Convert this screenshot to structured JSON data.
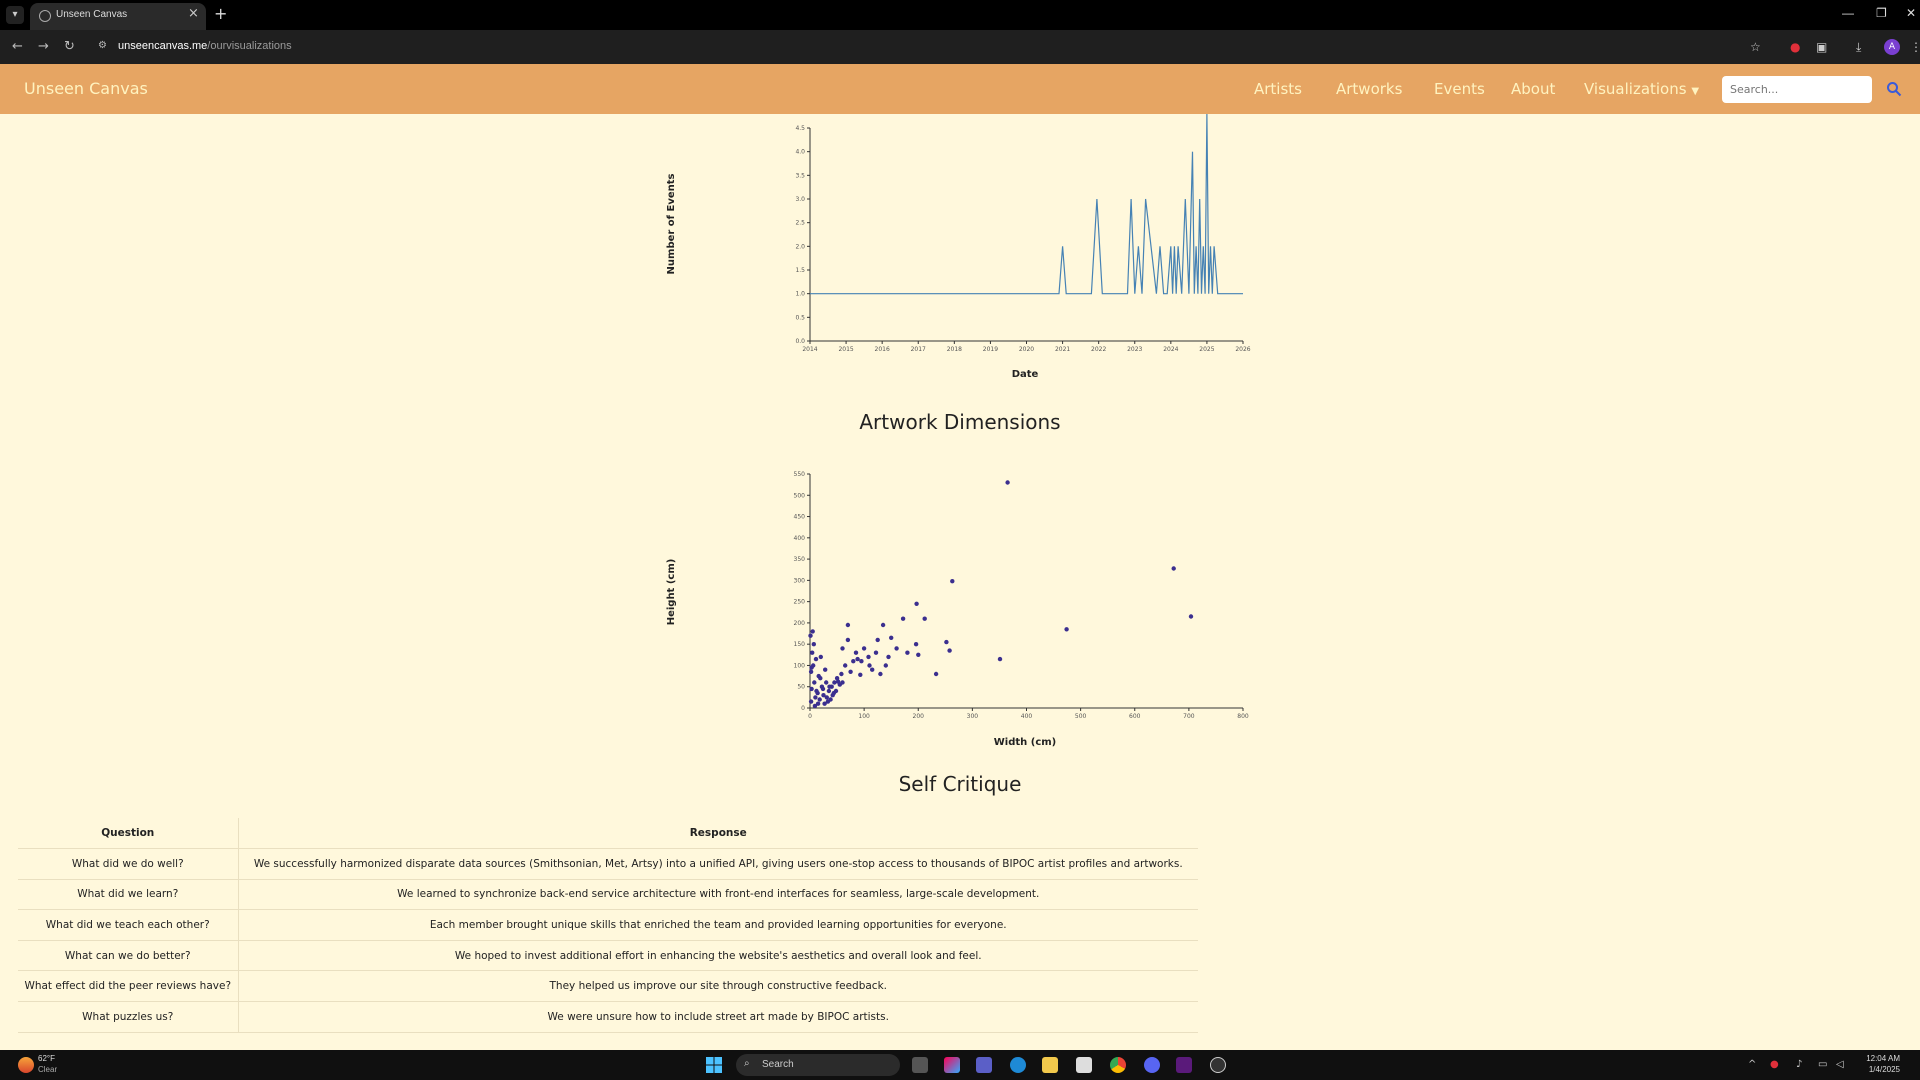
{
  "browser": {
    "tab_title": "Unseen Canvas",
    "url_domain": "unseencanvas.me",
    "url_path": "/ourvisualizations",
    "profile_initial": "A"
  },
  "site": {
    "brand": "Unseen Canvas",
    "nav": [
      "Artists",
      "Artworks",
      "Events",
      "About",
      "Visualizations"
    ],
    "search_placeholder": "Search...",
    "accent_color": "#e6a563",
    "background_color": "#fff8dc"
  },
  "charts": {
    "events": {
      "ylabel": "Number of Events",
      "xlabel": "Date"
    },
    "dimensions": {
      "title": "Artwork Dimensions",
      "ylabel": "Height (cm)",
      "xlabel": "Width (cm)"
    }
  },
  "chart_data": [
    {
      "type": "line",
      "title": "",
      "xlabel": "Date",
      "ylabel": "Number of Events",
      "xlim": [
        2014,
        2026
      ],
      "ylim": [
        0,
        4.5
      ],
      "x_ticks": [
        "2014",
        "2015",
        "2016",
        "2017",
        "2018",
        "2019",
        "2020",
        "2021",
        "2022",
        "2023",
        "2024",
        "2025",
        "2026"
      ],
      "y_ticks": [
        "0.0",
        "0.5",
        "1.0",
        "1.5",
        "2.0",
        "2.5",
        "3.0",
        "3.5",
        "4.0",
        "4.5"
      ],
      "color": "#4682b4",
      "x": [
        2014.0,
        2020.9,
        2021.0,
        2021.1,
        2021.8,
        2021.95,
        2022.1,
        2022.8,
        2022.9,
        2023.0,
        2023.1,
        2023.2,
        2023.3,
        2023.6,
        2023.7,
        2023.8,
        2023.9,
        2024.0,
        2024.05,
        2024.1,
        2024.15,
        2024.2,
        2024.3,
        2024.4,
        2024.5,
        2024.6,
        2024.65,
        2024.7,
        2024.75,
        2024.8,
        2024.85,
        2024.9,
        2024.95,
        2025.0,
        2025.05,
        2025.1,
        2025.15,
        2025.2,
        2025.3,
        2026.0
      ],
      "y": [
        1,
        1,
        2,
        1,
        1,
        3,
        1,
        1,
        3,
        1,
        2,
        1,
        3,
        1,
        2,
        1,
        1,
        2,
        1,
        2,
        1,
        2,
        1,
        3,
        1,
        4,
        1,
        2,
        1,
        3,
        1,
        2,
        1,
        5,
        1,
        2,
        1,
        2,
        1,
        1
      ]
    },
    {
      "type": "scatter",
      "title": "Artwork Dimensions",
      "xlabel": "Width (cm)",
      "ylabel": "Height (cm)",
      "xlim": [
        0,
        800
      ],
      "ylim": [
        0,
        550
      ],
      "x_ticks": [
        "0",
        "100",
        "200",
        "300",
        "400",
        "500",
        "600",
        "700",
        "800"
      ],
      "y_ticks": [
        "0",
        "50",
        "100",
        "150",
        "200",
        "250",
        "300",
        "350",
        "400",
        "450",
        "500",
        "550"
      ],
      "color": "#3b2f8f",
      "points": [
        [
          365,
          530
        ],
        [
          672,
          328
        ],
        [
          263,
          298
        ],
        [
          704,
          215
        ],
        [
          474,
          185
        ],
        [
          351,
          115
        ],
        [
          197,
          245
        ],
        [
          212,
          210
        ],
        [
          252,
          155
        ],
        [
          258,
          135
        ],
        [
          233,
          80
        ],
        [
          196,
          150
        ],
        [
          172,
          210
        ],
        [
          160,
          140
        ],
        [
          150,
          165
        ],
        [
          135,
          195
        ],
        [
          125,
          160
        ],
        [
          122,
          130
        ],
        [
          108,
          120
        ],
        [
          100,
          140
        ],
        [
          95,
          110
        ],
        [
          93,
          78
        ],
        [
          85,
          130
        ],
        [
          80,
          110
        ],
        [
          70,
          195
        ],
        [
          70,
          160
        ],
        [
          60,
          140
        ],
        [
          65,
          100
        ],
        [
          58,
          80
        ],
        [
          50,
          70
        ],
        [
          45,
          60
        ],
        [
          42,
          30
        ],
        [
          40,
          50
        ],
        [
          38,
          20
        ],
        [
          35,
          40
        ],
        [
          30,
          60
        ],
        [
          28,
          90
        ],
        [
          25,
          30
        ],
        [
          22,
          50
        ],
        [
          20,
          120
        ],
        [
          18,
          20
        ],
        [
          15,
          10
        ],
        [
          12,
          40
        ],
        [
          10,
          25
        ],
        [
          8,
          60
        ],
        [
          6,
          100
        ],
        [
          5,
          180
        ],
        [
          4,
          130
        ],
        [
          3,
          45
        ],
        [
          2,
          15
        ],
        [
          2,
          85
        ],
        [
          1,
          170
        ],
        [
          55,
          55
        ],
        [
          48,
          40
        ],
        [
          33,
          15
        ],
        [
          27,
          10
        ],
        [
          60,
          60
        ],
        [
          75,
          85
        ],
        [
          88,
          115
        ],
        [
          115,
          90
        ],
        [
          145,
          120
        ],
        [
          180,
          130
        ],
        [
          200,
          125
        ],
        [
          140,
          100
        ],
        [
          130,
          80
        ],
        [
          110,
          100
        ],
        [
          9,
          5
        ],
        [
          14,
          35
        ],
        [
          19,
          70
        ],
        [
          24,
          45
        ],
        [
          31,
          25
        ],
        [
          36,
          50
        ],
        [
          44,
          35
        ],
        [
          52,
          62
        ],
        [
          7,
          150
        ],
        [
          3,
          95
        ],
        [
          11,
          115
        ],
        [
          16,
          75
        ]
      ]
    }
  ],
  "critique": {
    "title": "Self Critique",
    "headers": [
      "Question",
      "Response"
    ],
    "rows": [
      [
        "What did we do well?",
        "We successfully harmonized disparate data sources (Smithsonian, Met, Artsy) into a unified API, giving users one-stop access to thousands of BIPOC artist profiles and artworks."
      ],
      [
        "What did we learn?",
        "We learned to synchronize back-end service architecture with front-end interfaces for seamless, large-scale development."
      ],
      [
        "What did we teach each other?",
        "Each member brought unique skills that enriched the team and provided learning opportunities for everyone."
      ],
      [
        "What can we do better?",
        "We hoped to invest additional effort in enhancing the website's aesthetics and overall look and feel."
      ],
      [
        "What effect did the peer reviews have?",
        "They helped us improve our site through constructive feedback."
      ],
      [
        "What puzzles us?",
        "We were unsure how to include street art made by BIPOC artists."
      ]
    ]
  },
  "taskbar": {
    "temperature": "62°F",
    "condition": "Clear",
    "search": "Search",
    "time": "12:04 AM",
    "date": "1/4/2025"
  }
}
